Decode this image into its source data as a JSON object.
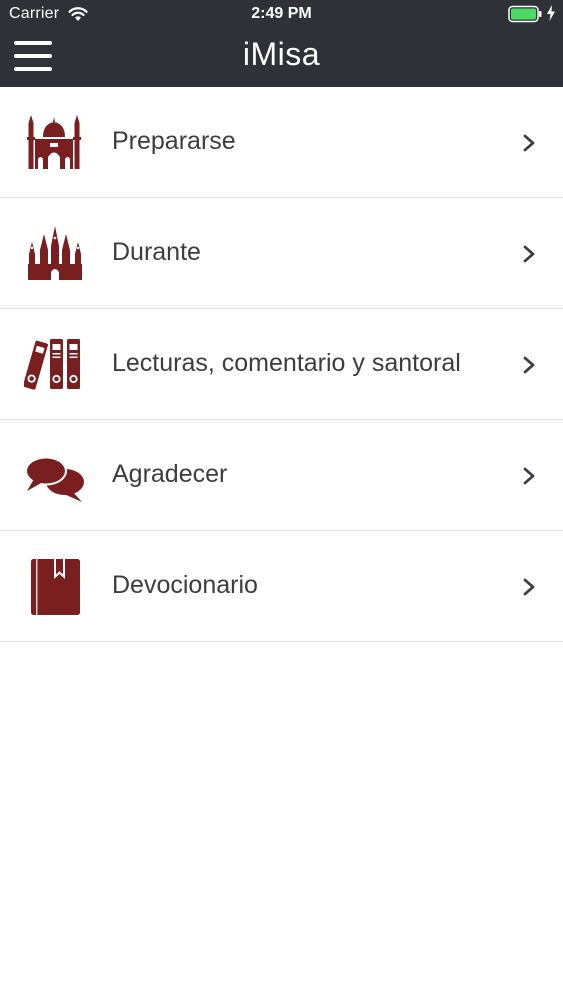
{
  "status_bar": {
    "carrier": "Carrier",
    "time": "2:49 PM",
    "wifi_icon": "wifi-icon",
    "battery_icon": "battery-icon",
    "charging_icon": "charging-bolt-icon",
    "battery_color": "#4cd964"
  },
  "navbar": {
    "title": "iMisa",
    "menu_icon": "hamburger-menu-icon",
    "background_color": "#2e3138"
  },
  "menu": {
    "icon_color": "#7a1f1f",
    "items": [
      {
        "label": "Prepararse",
        "icon": "mosque-icon"
      },
      {
        "label": "Durante",
        "icon": "cathedral-icon"
      },
      {
        "label": "Lecturas, comentario y santoral",
        "icon": "binders-icon"
      },
      {
        "label": "Agradecer",
        "icon": "speech-bubbles-icon"
      },
      {
        "label": "Devocionario",
        "icon": "bookmarked-book-icon"
      }
    ]
  }
}
